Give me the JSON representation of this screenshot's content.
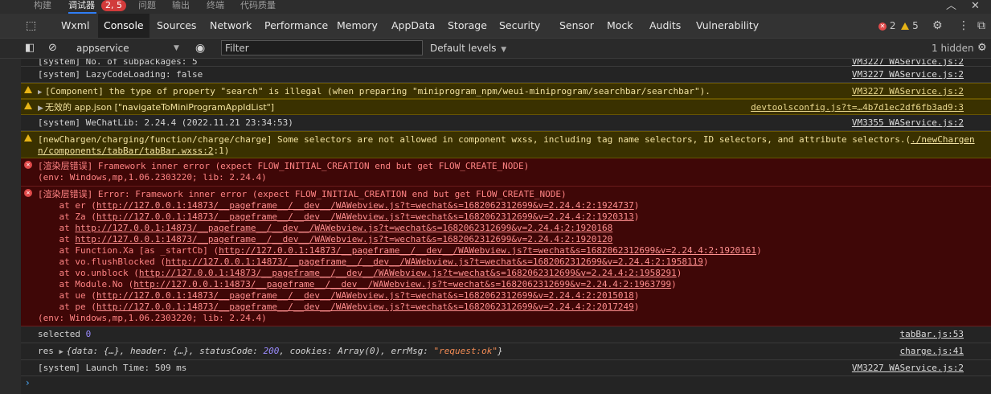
{
  "top_tabs": [
    "构建",
    "调试器",
    "问题",
    "输出",
    "终端",
    "代码质量"
  ],
  "top_badge": "2, 5",
  "top_icons": {
    "collapse": "chevron-up-icon",
    "close": "close-icon"
  },
  "tabs": [
    "Wxml",
    "Console",
    "Sources",
    "Network",
    "Performance",
    "Memory",
    "AppData",
    "Storage",
    "Security",
    "Sensor",
    "Mock",
    "Audits",
    "Vulnerability"
  ],
  "active_tab": "Console",
  "counts": {
    "errors": "2",
    "warnings": "5"
  },
  "filterbar": {
    "context": "appservice",
    "filter_placeholder": "Filter",
    "levels": "Default levels",
    "hidden": "1 hidden"
  },
  "logs": {
    "row0_msg": "[system] No. of subpackages: 5",
    "row0_src": "VM3227 WAService.js:2",
    "row1_msg": "[system] LazyCodeLoading: false",
    "row1_src": "VM3227 WAService.js:2",
    "row2_msg": "[Component] the type of property \"search\" is illegal (when preparing \"miniprogram_npm/weui-miniprogram/searchbar/searchbar\").",
    "row2_src": "VM3227 WAService.js:2",
    "row3_msg": "无效的 app.json [\"navigateToMiniProgramAppIdList\"]",
    "row3_src": "devtoolsconfig.js?t=…4b7d1ec2df6fb3ad9:3",
    "row4_msg": "[system] WeChatLib: 2.24.4 (2022.11.21 23:34:53)",
    "row4_src": "VM3355 WAService.js:2",
    "row5_msg1": "[newChargen/charging/function/charge/charge] Some selectors are not allowed in component wxss, including tag name selectors, ID selectors, and attribute selectors.(",
    "row5_link1": "./newChargen",
    "row5_link2": "n/components/tabBar/tabBar.wxss:2",
    "row5_tail": ":1)",
    "row6_msg": "[渲染层错误] Framework inner error (expect FLOW_INITIAL_CREATION end but get FLOW_CREATE_NODE)",
    "row6_env": "(env: Windows,mp,1.06.2303220; lib: 2.24.4)",
    "row7_msg": "[渲染层错误] Error: Framework inner error (expect FLOW_INITIAL_CREATION end but get FLOW_CREATE_NODE)",
    "row7_env": "(env: Windows,mp,1.06.2303220; lib: 2.24.4)",
    "stack": [
      {
        "prefix": "    at er (",
        "link": "http://127.0.0.1:14873/__pageframe__/__dev__/WAWebview.js?t=wechat&s=1682062312699&v=2.24.4:2:1924737",
        "suffix": ")"
      },
      {
        "prefix": "    at Za (",
        "link": "http://127.0.0.1:14873/__pageframe__/__dev__/WAWebview.js?t=wechat&s=1682062312699&v=2.24.4:2:1920313",
        "suffix": ")"
      },
      {
        "prefix": "    at ",
        "link": "http://127.0.0.1:14873/__pageframe__/__dev__/WAWebview.js?t=wechat&s=1682062312699&v=2.24.4:2:1920168",
        "suffix": ""
      },
      {
        "prefix": "    at ",
        "link": "http://127.0.0.1:14873/__pageframe__/__dev__/WAWebview.js?t=wechat&s=1682062312699&v=2.24.4:2:1920120",
        "suffix": ""
      },
      {
        "prefix": "    at Function.Xa [as _startCb] (",
        "link": "http://127.0.0.1:14873/__pageframe__/__dev__/WAWebview.js?t=wechat&s=1682062312699&v=2.24.4:2:1920161",
        "suffix": ")"
      },
      {
        "prefix": "    at vo.flushBlocked (",
        "link": "http://127.0.0.1:14873/__pageframe__/__dev__/WAWebview.js?t=wechat&s=1682062312699&v=2.24.4:2:1958119",
        "suffix": ")"
      },
      {
        "prefix": "    at vo.unblock (",
        "link": "http://127.0.0.1:14873/__pageframe__/__dev__/WAWebview.js?t=wechat&s=1682062312699&v=2.24.4:2:1958291",
        "suffix": ")"
      },
      {
        "prefix": "    at Module.No (",
        "link": "http://127.0.0.1:14873/__pageframe__/__dev__/WAWebview.js?t=wechat&s=1682062312699&v=2.24.4:2:1963799",
        "suffix": ")"
      },
      {
        "prefix": "    at ue (",
        "link": "http://127.0.0.1:14873/__pageframe__/__dev__/WAWebview.js?t=wechat&s=1682062312699&v=2.24.4:2:2015018",
        "suffix": ")"
      },
      {
        "prefix": "    at pe (",
        "link": "http://127.0.0.1:14873/__pageframe__/__dev__/WAWebview.js?t=wechat&s=1682062312699&v=2.24.4:2:2017249",
        "suffix": ")"
      }
    ],
    "row8_label": "selected",
    "row8_value": "0",
    "row8_src": "tabBar.js:53",
    "row9_label": "res",
    "row9_obj_a": "{data: {…}, header: {…}, statusCode: ",
    "row9_status": "200",
    "row9_obj_b": ", cookies: Array(0), errMsg: ",
    "row9_errmsg": "\"request:ok\"",
    "row9_obj_c": "}",
    "row9_src": "charge.js:41",
    "row10_msg": "[system] Launch Time: 509 ms",
    "row10_src": "VM3227 WAService.js:2"
  },
  "prompt": "›"
}
